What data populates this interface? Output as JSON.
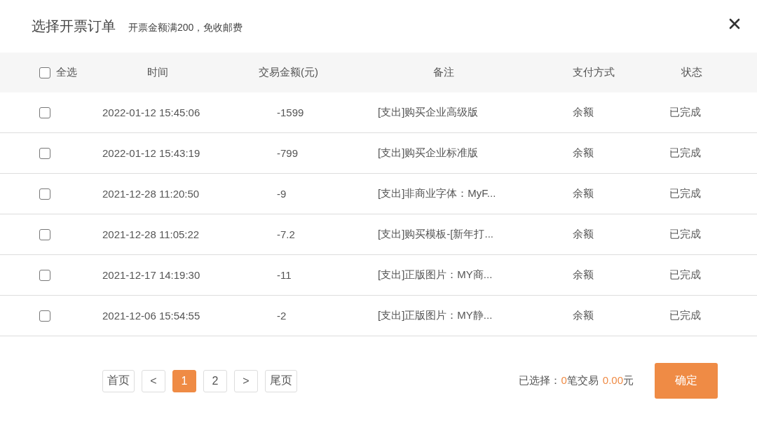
{
  "dialog": {
    "title": "选择开票订单",
    "subtitle": "开票金额满200，免收邮费"
  },
  "table": {
    "select_all": {
      "label": "全选",
      "checked": false
    },
    "columns": [
      "时间",
      "交易金额(元)",
      "备注",
      "支付方式",
      "状态"
    ],
    "rows": [
      {
        "checked": false,
        "cells": [
          "2022-01-12 15:45:06",
          "-1599",
          "[支出]购买企业高级版",
          "余额",
          "已完成"
        ]
      },
      {
        "checked": false,
        "cells": [
          "2022-01-12 15:43:19",
          "-799",
          "[支出]购买企业标准版",
          "余额",
          "已完成"
        ]
      },
      {
        "checked": false,
        "cells": [
          "2021-12-28 11:20:50",
          "-9",
          "[支出]非商业字体：MyF...",
          "余额",
          "已完成"
        ]
      },
      {
        "checked": false,
        "cells": [
          "2021-12-28 11:05:22",
          "-7.2",
          "[支出]购买模板-[新年打...",
          "余额",
          "已完成"
        ]
      },
      {
        "checked": false,
        "cells": [
          "2021-12-17 14:19:30",
          "-11",
          "[支出]正版图片：MY商...",
          "余额",
          "已完成"
        ]
      },
      {
        "checked": false,
        "cells": [
          "2021-12-06 15:54:55",
          "-2",
          "[支出]正版图片：MY静...",
          "余额",
          "已完成"
        ]
      }
    ]
  },
  "pagination": [
    {
      "label": "首页",
      "selected": false
    },
    {
      "label": "<",
      "selected": false
    },
    {
      "label": "1",
      "selected": true
    },
    {
      "label": "2",
      "selected": false
    },
    {
      "label": ">",
      "selected": false
    },
    {
      "label": "尾页",
      "selected": false
    }
  ],
  "summary": {
    "label": "已选择：",
    "count": "0",
    "count_unit": "笔交易",
    "amount": "0.00",
    "amount_unit": "元"
  },
  "confirm_button": "确定"
}
